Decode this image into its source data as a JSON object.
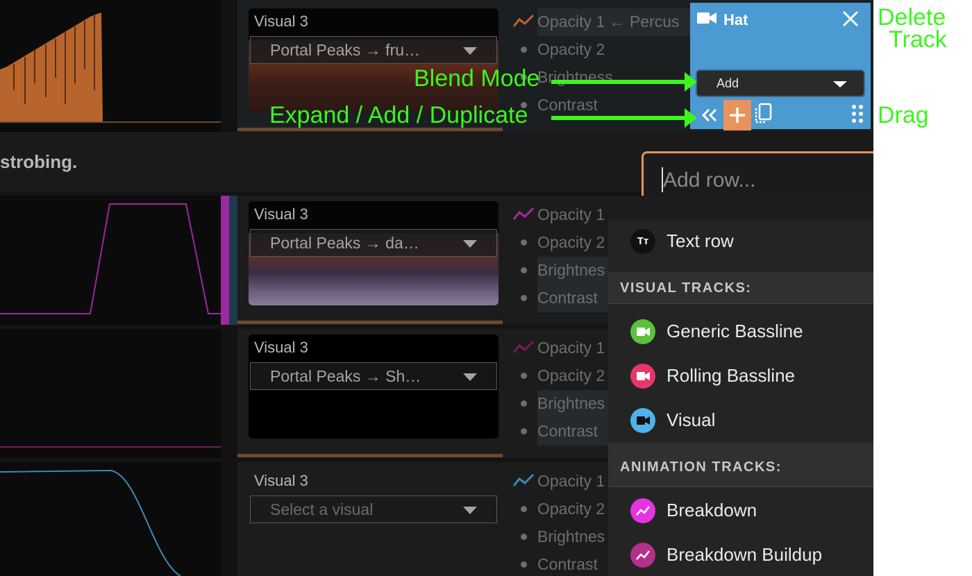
{
  "colors": {
    "annotation": "#3df51e",
    "hat_bg": "#4b9ad1",
    "add_row_border": "#e8935a",
    "add_button": "#e8935a",
    "generic_bassline": "#5bc23a",
    "rolling_bassline": "#e8356a",
    "visual": "#4fb2ec",
    "breakdown": "#e534e0",
    "breakdown_buildup": "#b4308a"
  },
  "note_text": "strobing.",
  "tracks": [
    {
      "label": "Visual 3",
      "select": "Portal Peaks → fru…",
      "params": [
        "Opacity 1 ← Percus",
        "Opacity 2",
        "Brightness",
        "Contrast"
      ]
    },
    {
      "label": "Visual 3",
      "select": "Portal Peaks → da…",
      "params": [
        "Opacity 1",
        "Opacity 2",
        "Brightnes",
        "Contrast"
      ]
    },
    {
      "label": "Visual 3",
      "select": "Portal Peaks → Sh…",
      "params": [
        "Opacity 1",
        "Opacity 2",
        "Brightnes",
        "Contrast"
      ]
    },
    {
      "label": "Visual 3",
      "select": "Select a visual",
      "params": [
        "Opacity 1",
        "Opacity 2",
        "Brightnes",
        "Contrast"
      ]
    }
  ],
  "hat_panel": {
    "title": "Hat",
    "title_icon": "video-camera-icon",
    "close_icon": "close-icon",
    "blend_mode_value": "Add",
    "controls": [
      "chevrons-left-icon",
      "plus-icon",
      "duplicate-icon",
      "drag-handle-icon"
    ]
  },
  "annotations": {
    "delete_track_line1": "Delete",
    "delete_track_line2": "Track",
    "blend_mode": "Blend Mode",
    "expand_add_duplicate": "Expand / Add / Duplicate",
    "drag": "Drag"
  },
  "add_row": {
    "placeholder": "Add row...",
    "text_row": "Text row",
    "visual_tracks_header": "VISUAL TRACKS:",
    "visual_tracks": [
      "Generic Bassline",
      "Rolling Bassline",
      "Visual"
    ],
    "animation_tracks_header": "ANIMATION TRACKS:",
    "animation_tracks": [
      "Breakdown",
      "Breakdown Buildup"
    ]
  }
}
